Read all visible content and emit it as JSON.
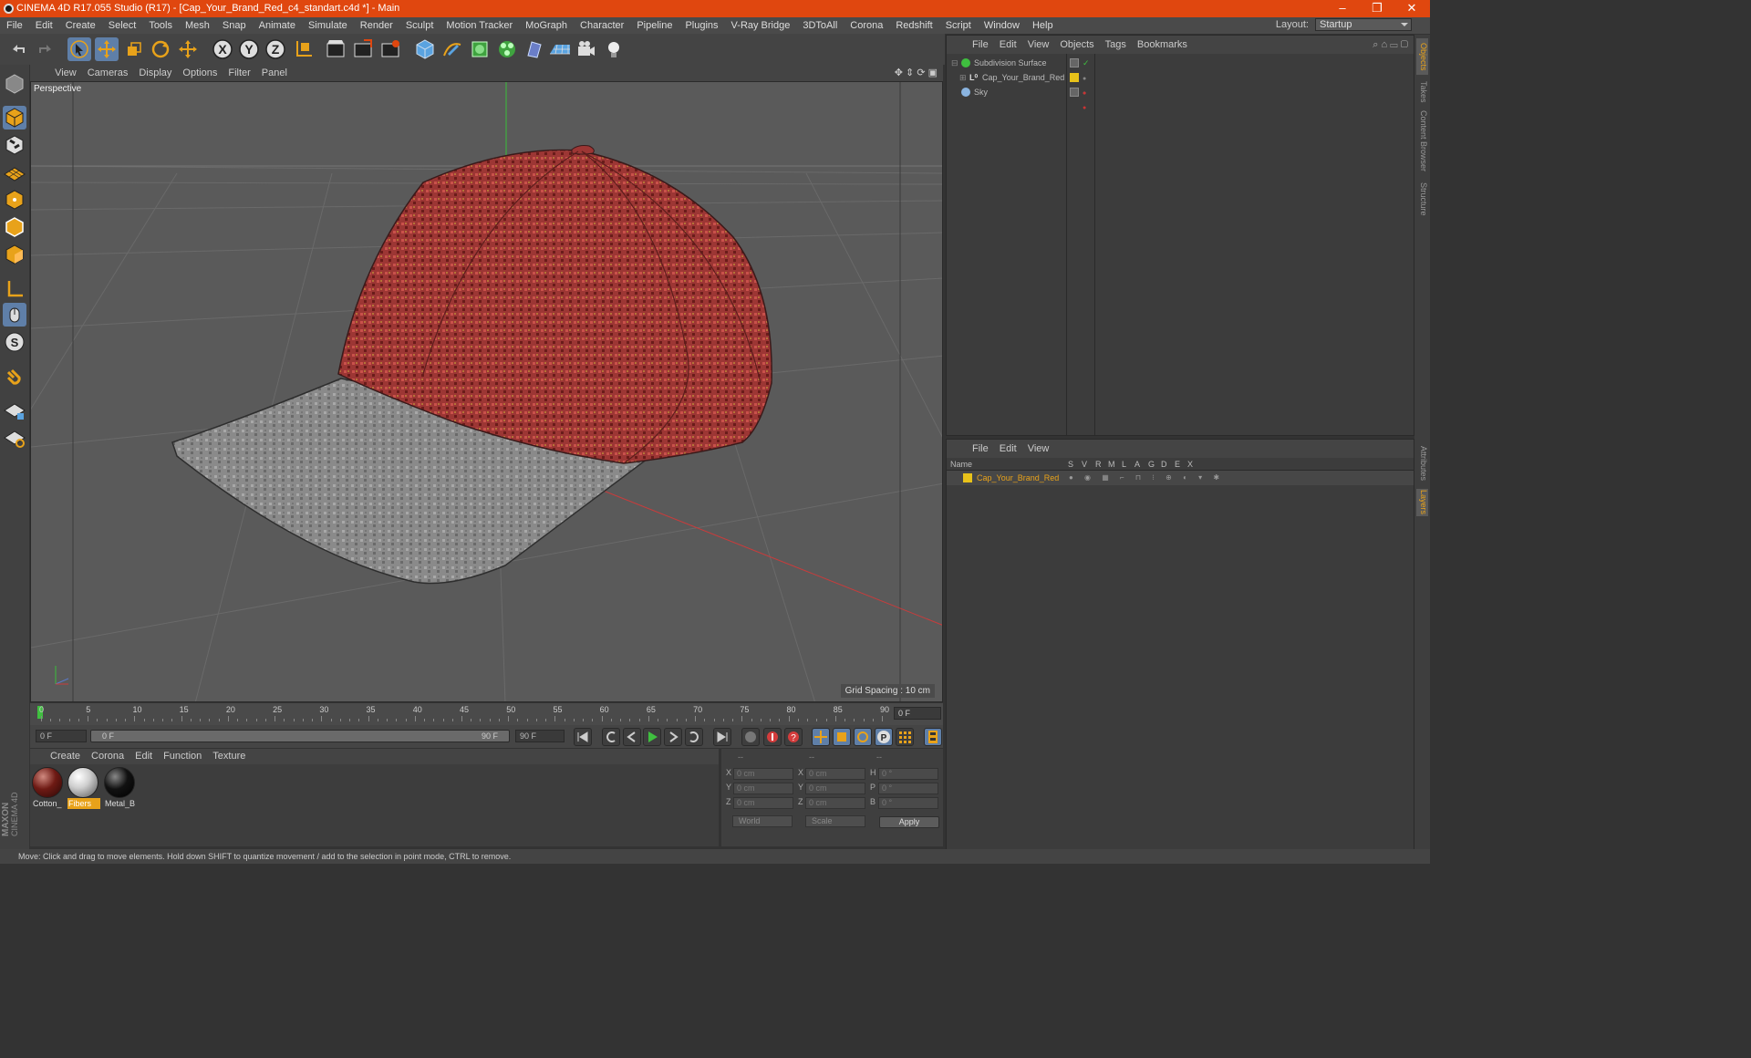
{
  "window": {
    "title": "CINEMA 4D R17.055 Studio (R17) - [Cap_Your_Brand_Red_c4_standart.c4d *] - Main"
  },
  "menubar": {
    "items": [
      "File",
      "Edit",
      "Create",
      "Select",
      "Tools",
      "Mesh",
      "Snap",
      "Animate",
      "Simulate",
      "Render",
      "Sculpt",
      "Motion Tracker",
      "MoGraph",
      "Character",
      "Pipeline",
      "Plugins",
      "V-Ray Bridge",
      "3DToAll",
      "Corona",
      "Redshift",
      "Script",
      "Window",
      "Help"
    ],
    "layout_label": "Layout:",
    "layout_value": "Startup"
  },
  "viewport": {
    "menu": [
      "View",
      "Cameras",
      "Display",
      "Options",
      "Filter",
      "Panel"
    ],
    "camera_label": "Perspective",
    "grid_spacing": "Grid Spacing : 10 cm"
  },
  "timeline": {
    "ticks": [
      "0",
      "5",
      "10",
      "15",
      "20",
      "25",
      "30",
      "35",
      "40",
      "45",
      "50",
      "55",
      "60",
      "65",
      "70",
      "75",
      "80",
      "85",
      "90"
    ],
    "current_frame": "0 F"
  },
  "transport": {
    "start_field": "0 F",
    "range_start": "0 F",
    "range_end": "90 F",
    "end_field": "90 F"
  },
  "materials": {
    "menu": [
      "Create",
      "Corona",
      "Edit",
      "Function",
      "Texture"
    ],
    "items": [
      {
        "name": "Cotton_",
        "color": "#6e1a14"
      },
      {
        "name": "Fibers",
        "color": "#cfcfcf"
      },
      {
        "name": "Metal_B",
        "color": "#111111"
      }
    ]
  },
  "coordinates": {
    "headers": [
      "--",
      "--",
      "--"
    ],
    "rows": [
      {
        "axis": "X",
        "pos": "0 cm",
        "axis2": "X",
        "size": "0 cm",
        "rot_axis": "H",
        "rot": "0 °"
      },
      {
        "axis": "Y",
        "pos": "0 cm",
        "axis2": "Y",
        "size": "0 cm",
        "rot_axis": "P",
        "rot": "0 °"
      },
      {
        "axis": "Z",
        "pos": "0 cm",
        "axis2": "Z",
        "size": "0 cm",
        "rot_axis": "B",
        "rot": "0 °"
      }
    ],
    "mode": "World",
    "transform": "Scale",
    "apply_label": "Apply"
  },
  "object_manager": {
    "menu": [
      "File",
      "Edit",
      "View",
      "Objects",
      "Tags",
      "Bookmarks"
    ],
    "objects": [
      {
        "name": "Subdivision Surface"
      },
      {
        "name": "Cap_Your_Brand_Red"
      },
      {
        "name": "Sky"
      }
    ]
  },
  "layer_manager": {
    "menu": [
      "File",
      "Edit",
      "View"
    ],
    "columns": [
      "Name",
      "S",
      "V",
      "R",
      "M",
      "L",
      "A",
      "G",
      "D",
      "E",
      "X"
    ],
    "layers": [
      {
        "name": "Cap_Your_Brand_Red",
        "color": "#e8c21a"
      }
    ]
  },
  "right_tabs": [
    "Objects",
    "Takes",
    "Content Browser",
    "Structure",
    "Attributes",
    "Layers"
  ],
  "status": {
    "text": "Move: Click and drag to move elements. Hold down SHIFT to quantize movement / add to the selection in point mode, CTRL to remove."
  },
  "branding": {
    "logo_text": "MAXON CINEMA 4D"
  },
  "colors": {
    "title_bar": "#e0470f",
    "accent": "#e8a21a",
    "selected_tool": "#5f7fa8"
  }
}
